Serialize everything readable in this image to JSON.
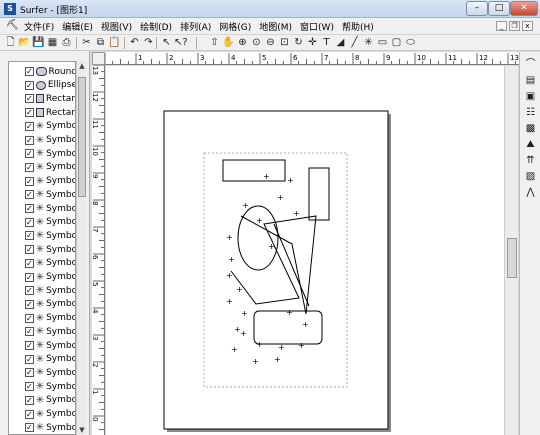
{
  "window": {
    "title": "Surfer - [图形1]",
    "app_icon_letter": "S",
    "minimize": "–",
    "maximize": "□",
    "close": "✕"
  },
  "menubar": {
    "items": [
      {
        "label": "文件(F)"
      },
      {
        "label": "编辑(E)"
      },
      {
        "label": "视图(V)"
      },
      {
        "label": "绘制(D)"
      },
      {
        "label": "排列(A)"
      },
      {
        "label": "网格(G)"
      },
      {
        "label": "地图(M)"
      },
      {
        "label": "窗口(W)"
      },
      {
        "label": "帮助(H)"
      }
    ],
    "doc_minimize": "_",
    "doc_restore": "❐",
    "doc_close": "x"
  },
  "toolbar": {
    "icons": [
      "new-icon",
      "open-icon",
      "save-icon",
      "table-icon",
      "print-icon",
      "cut-icon",
      "copy-icon",
      "paste-icon",
      "undo-icon",
      "redo-icon",
      "select-icon",
      "help-pointer-icon",
      "move-icon",
      "pan-icon",
      "zoom-in-icon",
      "zoom-fit-icon",
      "zoom-out-icon",
      "zoom-page-icon",
      "rotate-icon",
      "crosshair-icon",
      "text-icon",
      "polygon-icon",
      "polyline-icon",
      "symbol-icon",
      "rectangle-icon",
      "rounded-rectangle-icon",
      "ellipse-icon"
    ],
    "glyphs": [
      "🗋",
      "📂",
      "💾",
      "▦",
      "⎙",
      "✂",
      "⧉",
      "📋",
      "↶",
      "↷",
      "↖",
      "↖?",
      "⇧",
      "✋",
      "⊕",
      "⊙",
      "⊖",
      "⊡",
      "↻",
      "✛",
      "T",
      "◢",
      "╱",
      "✳",
      "▭",
      "▢",
      "⬭"
    ]
  },
  "object_manager": {
    "items": [
      {
        "label": "Round",
        "icon": "round-rect"
      },
      {
        "label": "Ellipse",
        "icon": "ellipse"
      },
      {
        "label": "Rectan",
        "icon": "rect"
      },
      {
        "label": "Rectan",
        "icon": "rect"
      },
      {
        "label": "Symbo",
        "icon": "symbol"
      },
      {
        "label": "Symbo",
        "icon": "symbol"
      },
      {
        "label": "Symbo",
        "icon": "symbol"
      },
      {
        "label": "Symbo",
        "icon": "symbol"
      },
      {
        "label": "Symbo",
        "icon": "symbol"
      },
      {
        "label": "Symbo",
        "icon": "symbol"
      },
      {
        "label": "Symbo",
        "icon": "symbol"
      },
      {
        "label": "Symbo",
        "icon": "symbol"
      },
      {
        "label": "Symbo",
        "icon": "symbol"
      },
      {
        "label": "Symbo",
        "icon": "symbol"
      },
      {
        "label": "Symbo",
        "icon": "symbol"
      },
      {
        "label": "Symbo",
        "icon": "symbol"
      },
      {
        "label": "Symbo",
        "icon": "symbol"
      },
      {
        "label": "Symbo",
        "icon": "symbol"
      },
      {
        "label": "Symbo",
        "icon": "symbol"
      },
      {
        "label": "Symbo",
        "icon": "symbol"
      },
      {
        "label": "Symbo",
        "icon": "symbol"
      },
      {
        "label": "Symbo",
        "icon": "symbol"
      },
      {
        "label": "Symbo",
        "icon": "symbol"
      },
      {
        "label": "Symbo",
        "icon": "symbol"
      },
      {
        "label": "Symbo",
        "icon": "symbol"
      },
      {
        "label": "Symbo",
        "icon": "symbol"
      },
      {
        "label": "Symbo",
        "icon": "symbol"
      },
      {
        "label": "Symbo",
        "icon": "symbol"
      }
    ],
    "checkmark": "✓",
    "scroll_up": "▲",
    "scroll_down": "▼"
  },
  "rulers": {
    "horizontal_labels": [
      "1",
      "2",
      "3",
      "4",
      "5",
      "6",
      "7",
      "8",
      "9",
      "10",
      "11",
      "12",
      "13"
    ],
    "vertical_labels": [
      "13",
      "12",
      "11",
      "10",
      "9",
      "8",
      "7",
      "6",
      "5",
      "4",
      "3",
      "2",
      "1",
      "0"
    ]
  },
  "right_toolbar": {
    "icons": [
      "curved-map-icon",
      "base-map-icon",
      "contour-map-icon",
      "post-map-icon",
      "image-map-icon",
      "shaded-relief-icon",
      "vector-map-icon",
      "3d-surface-icon",
      "wireframe-icon"
    ],
    "glyphs": [
      "⌒",
      "▤",
      "▣",
      "☷",
      "▩",
      "⛰",
      "⇈",
      "▨",
      "⋀"
    ]
  },
  "colors": {
    "title_gradient_top": "#dbe6f4",
    "page_border": "#000000",
    "margin_dash": "#999999"
  }
}
